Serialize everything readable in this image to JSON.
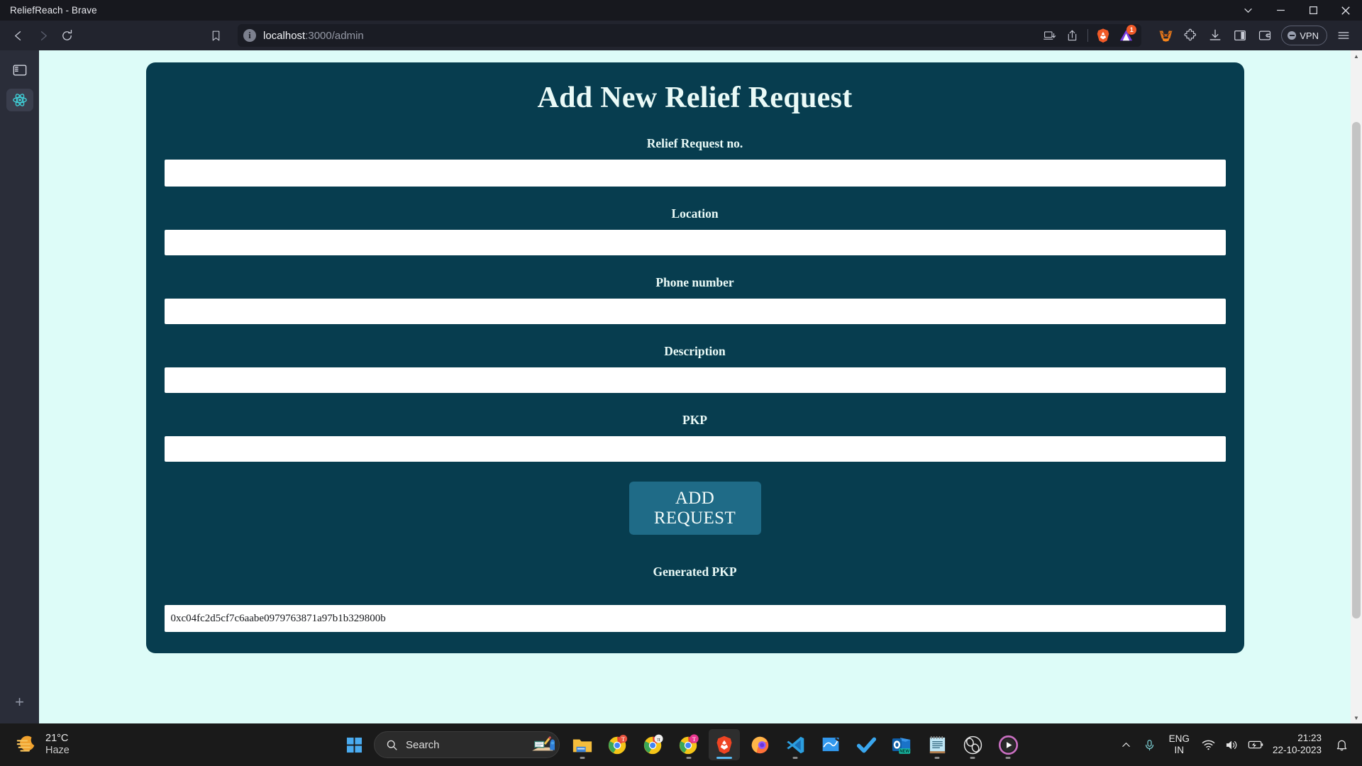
{
  "window": {
    "title": "ReliefReach - Brave",
    "controls": [
      {
        "name": "window-menu-chevron",
        "glyph": "chevron-down-icon"
      },
      {
        "name": "minimize",
        "glyph": "minimize-icon"
      },
      {
        "name": "maximize",
        "glyph": "maximize-icon"
      },
      {
        "name": "close",
        "glyph": "close-icon"
      }
    ]
  },
  "browser": {
    "nav": {
      "back": "back-arrow-icon",
      "forward": "forward-arrow-icon",
      "reload": "reload-icon",
      "bookmark": "bookmark-icon"
    },
    "url": {
      "info_glyph": "i",
      "host": "localhost",
      "path": ":3000/admin",
      "full": "localhost:3000/admin"
    },
    "url_actions": [
      {
        "name": "save-to-device-icon"
      },
      {
        "name": "share-icon"
      }
    ],
    "brave_shields": {
      "name": "brave-shields-icon",
      "badge": "1"
    },
    "extensions": [
      {
        "name": "metamask-icon",
        "label": "MetaMask"
      },
      {
        "name": "puzzle-extensions-icon",
        "label": "Extensions"
      },
      {
        "name": "downloads-icon",
        "label": "Downloads"
      },
      {
        "name": "sidebar-toggle-icon",
        "label": "Sidebar"
      },
      {
        "name": "brave-wallet-icon",
        "label": "Brave Wallet"
      }
    ],
    "vpn_label": "VPN",
    "menu": "hamburger-menu-icon",
    "sidebar": {
      "toggle": "vertical-tabs-toggle-icon",
      "tabs": [
        {
          "name": "tab-react-app",
          "icon": "react-logo-icon",
          "active": true
        }
      ],
      "new_tab": "+"
    }
  },
  "page": {
    "card_title": "Add New Relief Request",
    "fields": [
      {
        "label": "Relief Request no.",
        "value": "",
        "placeholder": "",
        "name": "relief-request-no"
      },
      {
        "label": "Location",
        "value": "",
        "placeholder": "",
        "name": "location"
      },
      {
        "label": "Phone number",
        "value": "",
        "placeholder": "",
        "name": "phone-number"
      },
      {
        "label": "Description",
        "value": "",
        "placeholder": "",
        "name": "description"
      },
      {
        "label": "PKP",
        "value": "",
        "placeholder": "",
        "name": "pkp"
      }
    ],
    "submit_label": "ADD REQUEST",
    "generated_label": "Generated PKP",
    "generated_value": "0xc04fc2d5cf7c6aabe0979763871a97b1b329800b",
    "colors": {
      "page_background": "#ddfcf8",
      "card_background": "#073d4f",
      "button_background": "#1f6b87",
      "text_on_card": "#eafaf7"
    }
  },
  "taskbar": {
    "weather": {
      "temperature": "21°C",
      "condition": "Haze",
      "icon": "haze-moon-icon"
    },
    "start": "windows-start-icon",
    "search_placeholder": "Search",
    "search_icon": "search-icon",
    "search_illustration": "notebook-pen-icon",
    "apps": [
      {
        "name": "file-explorer-icon",
        "label": "File Explorer",
        "running": true,
        "active": false
      },
      {
        "name": "chrome-profile-t-icon",
        "label": "Chrome",
        "running": false,
        "active": false
      },
      {
        "name": "chrome-profile-pi-icon",
        "label": "Chrome",
        "running": false,
        "active": false
      },
      {
        "name": "chrome-profile-t-pink-icon",
        "label": "Chrome",
        "running": true,
        "active": false
      },
      {
        "name": "brave-icon",
        "label": "Brave",
        "running": true,
        "active": true
      },
      {
        "name": "firefox-icon",
        "label": "Firefox",
        "running": false,
        "active": false
      },
      {
        "name": "vs-code-icon",
        "label": "Visual Studio Code",
        "running": true,
        "active": false
      },
      {
        "name": "whiteboard-icon",
        "label": "Whiteboard",
        "running": false,
        "active": false
      },
      {
        "name": "todoist-check-icon",
        "label": "Todoist",
        "running": false,
        "active": false
      },
      {
        "name": "outlook-new-icon",
        "label": "Outlook (new)",
        "running": false,
        "active": false
      },
      {
        "name": "notepad-icon",
        "label": "Notepad",
        "running": true,
        "active": false
      },
      {
        "name": "obs-studio-icon",
        "label": "OBS Studio",
        "running": true,
        "active": false
      },
      {
        "name": "media-player-icon",
        "label": "Media Player",
        "running": true,
        "active": false
      }
    ],
    "tray": {
      "overflow": "chevron-up-icon",
      "microphone": "microphone-icon",
      "language_line1": "ENG",
      "language_line2": "IN",
      "wifi": "wifi-icon",
      "volume": "volume-icon",
      "battery": "battery-charging-icon",
      "time": "21:23",
      "date": "22-10-2023",
      "notifications": "bell-icon"
    }
  }
}
